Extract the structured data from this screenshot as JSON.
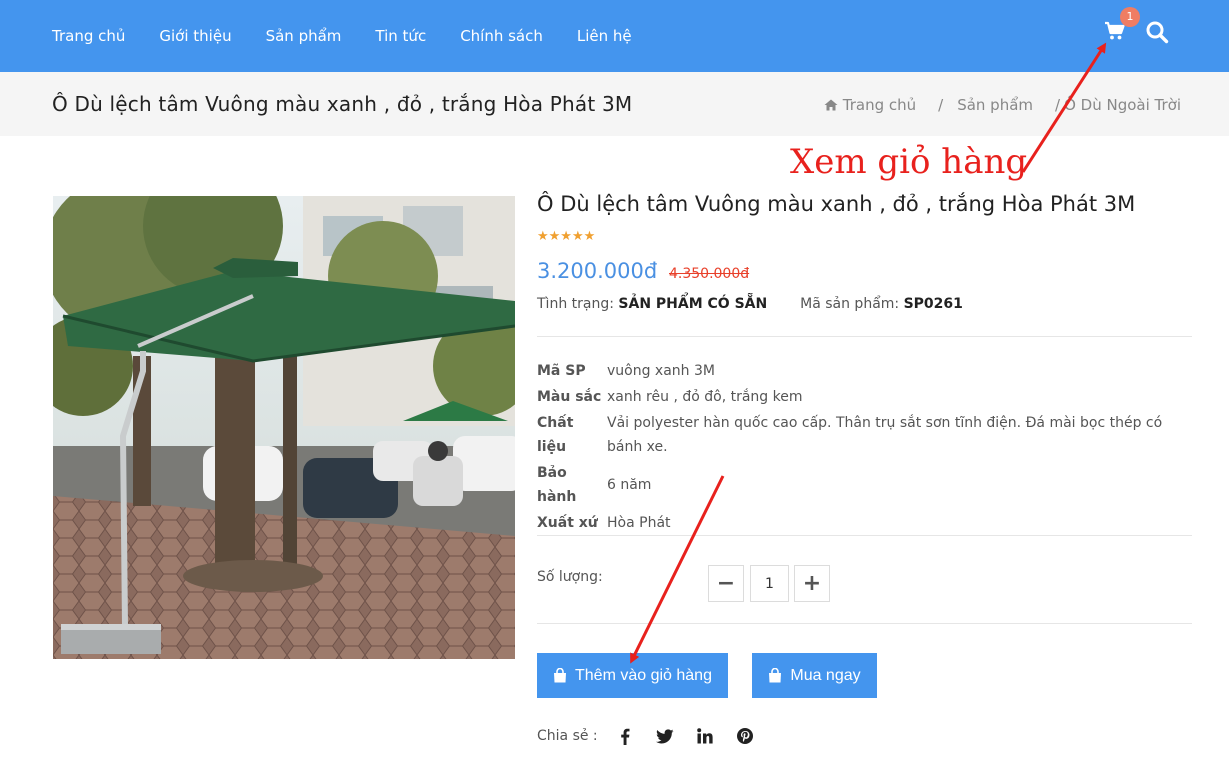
{
  "nav": {
    "items": [
      "Trang chủ",
      "Giới thiệu",
      "Sản phẩm",
      "Tin tức",
      "Chính sách",
      "Liên hệ"
    ],
    "cart_count": "1",
    "icons": [
      "cart-icon",
      "search-icon"
    ]
  },
  "breadcrumb_bar": {
    "page_title": "Ô Dù lệch tâm Vuông màu xanh , đỏ , trắng Hòa Phát 3M",
    "crumbs": [
      "Trang chủ",
      "Sản phẩm",
      "Ô Dù Ngoài Trời"
    ],
    "separator": "/"
  },
  "annotation": {
    "text": "Xem giỏ hàng",
    "color": "#e8211d"
  },
  "product": {
    "title": "Ô Dù lệch tâm Vuông màu xanh , đỏ , trắng Hòa Phát 3M",
    "rating": 5,
    "stars": "★★★★★",
    "price": "3.200.000đ",
    "old_price": "4.350.000đ",
    "status_label": "Tình trạng:",
    "status_value": "SẢN PHẨM CÓ SẴN",
    "sku_label": "Mã sản phẩm:",
    "sku_value": "SP0261",
    "specs": [
      {
        "label": "Mã SP",
        "value": "vuông xanh 3M"
      },
      {
        "label": "Màu sắc",
        "value": "xanh rêu , đỏ đô, trắng kem"
      },
      {
        "label": "Chất liệu",
        "value": "Vải polyester hàn quốc cao cấp. Thân trụ sắt sơn tĩnh điện. Đá mài bọc thép có bánh xe."
      },
      {
        "label": "Bảo hành",
        "value": "6 năm"
      },
      {
        "label": "Xuất xứ",
        "value": "Hòa Phát"
      }
    ],
    "quantity_label": "Số lượng:",
    "quantity_value": "1",
    "minus": "−",
    "plus": "+",
    "add_to_cart": "Thêm vào giỏ hàng",
    "buy_now": "Mua ngay",
    "share_label": "Chia sẻ :",
    "share_icons": [
      "facebook-icon",
      "twitter-icon",
      "linkedin-icon",
      "pinterest-icon"
    ]
  },
  "colors": {
    "primary": "#4495ee",
    "price": "#4a90e2",
    "old_price": "#e8402a",
    "badge": "#ef7d63",
    "stars": "#f0a030"
  }
}
